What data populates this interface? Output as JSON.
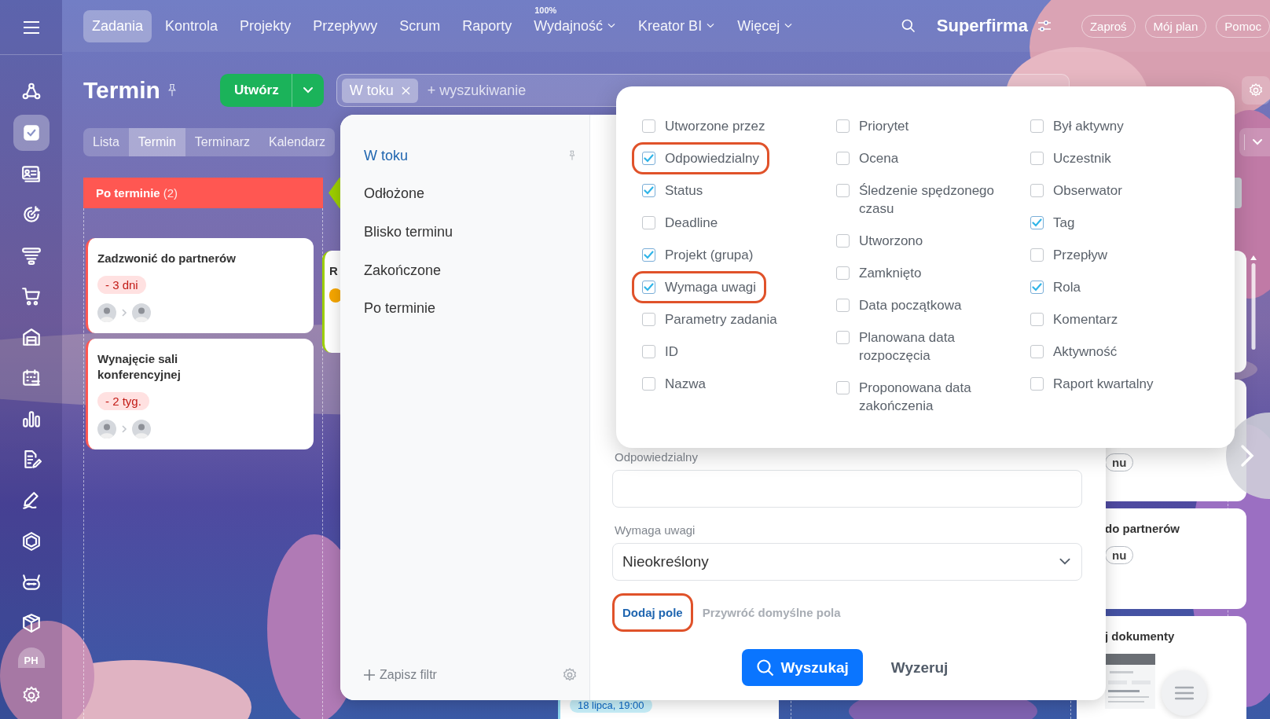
{
  "sidebar": {
    "items": [
      {
        "selected": false
      },
      {
        "selected": true
      },
      {
        "selected": false
      },
      {
        "selected": false
      },
      {
        "selected": false
      },
      {
        "selected": false
      },
      {
        "selected": false
      },
      {
        "selected": false
      },
      {
        "selected": false
      },
      {
        "selected": false
      },
      {
        "selected": false
      },
      {
        "selected": false
      },
      {
        "selected": false
      },
      {
        "selected": false
      }
    ],
    "avatar": "PH"
  },
  "top_nav": {
    "items": [
      {
        "label": "Zadania",
        "selected": true,
        "dropdown": false
      },
      {
        "label": "Kontrola",
        "selected": false,
        "dropdown": false
      },
      {
        "label": "Projekty",
        "selected": false,
        "dropdown": false
      },
      {
        "label": "Przepływy",
        "selected": false,
        "dropdown": false
      },
      {
        "label": "Scrum",
        "selected": false,
        "dropdown": false
      },
      {
        "label": "Raporty",
        "selected": false,
        "dropdown": false
      },
      {
        "label": "Wydajność",
        "selected": false,
        "dropdown": true,
        "badge": "100%"
      },
      {
        "label": "Kreator BI",
        "selected": false,
        "dropdown": true
      },
      {
        "label": "Więcej",
        "selected": false,
        "dropdown": true
      }
    ],
    "company": "Superfirma",
    "buttons": [
      "Zaproś",
      "Mój plan",
      "Pomoc"
    ]
  },
  "page": {
    "title": "Termin",
    "create_button": "Utwórz",
    "search": {
      "chips": [
        "W toku"
      ],
      "placeholder": "+ wyszukiwanie"
    }
  },
  "view_tabs": [
    {
      "label": "Lista",
      "selected": false
    },
    {
      "label": "Termin",
      "selected": true
    },
    {
      "label": "Terminarz",
      "selected": false
    },
    {
      "label": "Kalendarz",
      "selected": false
    }
  ],
  "board": {
    "columns": [
      {
        "title": "Po terminie",
        "count": "(2)",
        "color": "#ff5752",
        "cards": [
          {
            "title": "Zadzwonić do partnerów",
            "deadline": "- 3 dni",
            "kind": "overdue",
            "avatars": true
          },
          {
            "title": "Wynajęcie sali konferencyjnej",
            "deadline": "- 2 tyg.",
            "kind": "overdue",
            "avatars": true
          }
        ]
      },
      {
        "color": "#9dcf00",
        "cards": [
          {
            "title": "R",
            "kind": "soon",
            "avatars": false
          }
        ]
      },
      {
        "cards": [
          {
            "deadline": "18 lipca, 19:00",
            "kind": "normal",
            "avatars": false
          }
        ]
      },
      {},
      {
        "color": "#c8ccd3",
        "cards": [
          {
            "kind": "plain",
            "avatars": false
          },
          {
            "deadline": "nu",
            "kind": "outline",
            "avatars": false
          },
          {
            "title": "do partnerów",
            "deadline": "nu",
            "kind": "outline",
            "avatars": false
          },
          {
            "title": "j dokumenty",
            "kind": "plain",
            "avatars": false,
            "thumbnail": true
          }
        ]
      }
    ]
  },
  "filter": {
    "presets": [
      {
        "label": "W toku",
        "selected": true
      },
      {
        "label": "Odłożone",
        "selected": false
      },
      {
        "label": "Blisko terminu",
        "selected": false
      },
      {
        "label": "Zakończone",
        "selected": false
      },
      {
        "label": "Po terminie",
        "selected": false
      }
    ],
    "save_filter": "Zapisz filtr",
    "fields": [
      {
        "label": "Odpowiedzialny",
        "kind": "text"
      },
      {
        "label": "Wymaga uwagi",
        "kind": "select",
        "value": "Nieokreślony"
      }
    ],
    "add_field": {
      "label": "Dodaj pole",
      "highlighted": true
    },
    "restore": "Przywróć domyślne pola",
    "search_button": "Wyszukaj",
    "reset_button": "Wyzeruj"
  },
  "field_chooser": {
    "columns": [
      [
        {
          "label": "Utworzone przez",
          "checked": false,
          "highlighted": false
        },
        {
          "label": "Odpowiedzialny",
          "checked": true,
          "highlighted": true
        },
        {
          "label": "Status",
          "checked": true,
          "highlighted": false
        },
        {
          "label": "Deadline",
          "checked": false,
          "highlighted": false
        },
        {
          "label": "Projekt (grupa)",
          "checked": true,
          "highlighted": false
        },
        {
          "label": "Wymaga uwagi",
          "checked": true,
          "highlighted": true
        },
        {
          "label": "Parametry zadania",
          "checked": false,
          "highlighted": false
        },
        {
          "label": "ID",
          "checked": false,
          "highlighted": false
        },
        {
          "label": "Nazwa",
          "checked": false,
          "highlighted": false
        }
      ],
      [
        {
          "label": "Priorytet",
          "checked": false,
          "highlighted": false
        },
        {
          "label": "Ocena",
          "checked": false,
          "highlighted": false
        },
        {
          "label": "Śledzenie spędzonego czasu",
          "checked": false,
          "highlighted": false
        },
        {
          "label": "Utworzono",
          "checked": false,
          "highlighted": false
        },
        {
          "label": "Zamknięto",
          "checked": false,
          "highlighted": false
        },
        {
          "label": "Data początkowa",
          "checked": false,
          "highlighted": false
        },
        {
          "label": "Planowana data rozpoczęcia",
          "checked": false,
          "highlighted": false
        },
        {
          "label": "Proponowana data zakończenia",
          "checked": false,
          "highlighted": false
        }
      ],
      [
        {
          "label": "Był aktywny",
          "checked": false,
          "highlighted": false
        },
        {
          "label": "Uczestnik",
          "checked": false,
          "highlighted": false
        },
        {
          "label": "Obserwator",
          "checked": false,
          "highlighted": false
        },
        {
          "label": "Tag",
          "checked": true,
          "highlighted": false
        },
        {
          "label": "Przepływ",
          "checked": false,
          "highlighted": false
        },
        {
          "label": "Rola",
          "checked": true,
          "highlighted": false
        },
        {
          "label": "Komentarz",
          "checked": false,
          "highlighted": false
        },
        {
          "label": "Aktywność",
          "checked": false,
          "highlighted": false
        },
        {
          "label": "Raport kwartalny",
          "checked": false,
          "highlighted": false
        }
      ]
    ]
  }
}
